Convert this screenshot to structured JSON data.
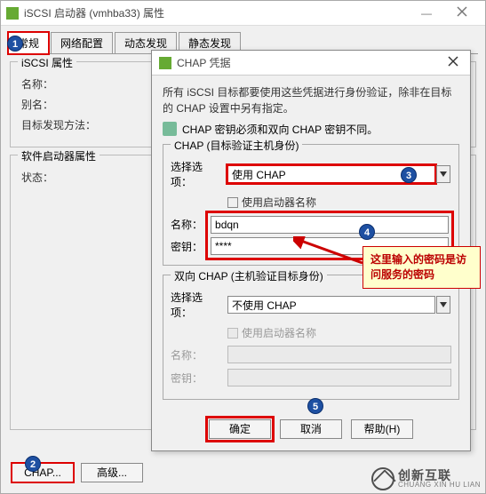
{
  "mainWindow": {
    "title": "iSCSI 启动器 (vmhba33) 属性",
    "tabs": [
      "常规",
      "网络配置",
      "动态发现",
      "静态发现"
    ],
    "activeTab": 0,
    "groupIscsi": {
      "legend": "iSCSI 属性",
      "nameLabel": "名称：",
      "aliasLabel": "别名：",
      "discoveryLabel": "目标发现方法："
    },
    "groupSoftware": {
      "legend": "软件启动器属性",
      "statusLabel": "状态："
    },
    "buttons": {
      "chap": "CHAP...",
      "advanced": "高级..."
    }
  },
  "chapDialog": {
    "title": "CHAP 凭据",
    "desc": "所有 iSCSI 目标都要使用这些凭据进行身份验证，除非在目标的 CHAP 设置中另有指定。",
    "info": "CHAP 密钥必须和双向 CHAP 密钥不同。",
    "group1": {
      "legend": "CHAP (目标验证主机身份)",
      "optLabel": "选择选项：",
      "optValue": "使用 CHAP",
      "useInitiator": "使用启动器名称",
      "nameLabel": "名称：",
      "nameValue": "bdqn",
      "secretLabel": "密钥：",
      "secretValue": "****"
    },
    "group2": {
      "legend": "双向 CHAP (主机验证目标身份)",
      "optLabel": "选择选项：",
      "optValue": "不使用 CHAP",
      "useInitiator": "使用启动器名称",
      "nameLabel": "名称：",
      "secretLabel": "密钥："
    },
    "buttons": {
      "ok": "确定",
      "cancel": "取消",
      "help": "帮助(H)"
    }
  },
  "callouts": {
    "b1": "1",
    "b2": "2",
    "b3": "3",
    "b4": "4",
    "b5": "5",
    "tooltip": "这里输入的密码是访问服务的密码"
  },
  "watermark": {
    "cn": "创新互联",
    "en": "CHUANG XIN HU LIAN"
  }
}
